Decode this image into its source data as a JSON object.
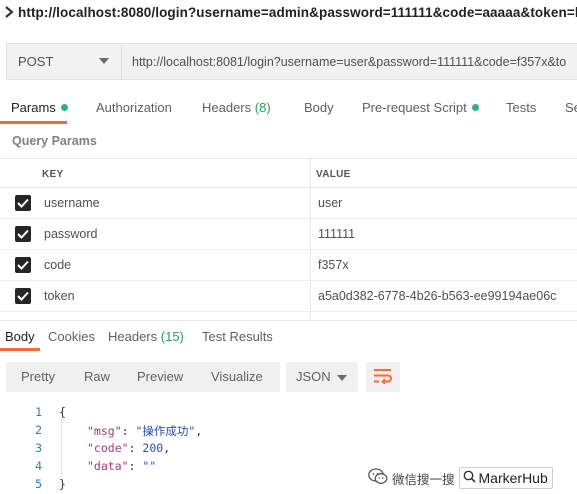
{
  "request_tab": {
    "title": "http://localhost:8080/login?username=admin&password=111111&code=aaaaa&token=b"
  },
  "request": {
    "method": "POST",
    "url": "http://localhost:8081/login?username=user&password=111111&code=f357x&to"
  },
  "request_tabs": [
    {
      "label": "Params",
      "dot": true,
      "active": true
    },
    {
      "label": "Authorization"
    },
    {
      "label": "Headers",
      "count": "(8)"
    },
    {
      "label": "Body"
    },
    {
      "label": "Pre-request Script",
      "dot": true
    },
    {
      "label": "Tests"
    },
    {
      "label": "Se"
    }
  ],
  "query_params": {
    "title": "Query Params",
    "columns": [
      "KEY",
      "VALUE"
    ],
    "rows": [
      {
        "checked": true,
        "key": "username",
        "value": "user"
      },
      {
        "checked": true,
        "key": "password",
        "value": "111111"
      },
      {
        "checked": true,
        "key": "code",
        "value": "f357x"
      },
      {
        "checked": true,
        "key": "token",
        "value": "a5a0d382-6778-4b26-b563-ee99194ae06c"
      }
    ]
  },
  "response_tabs": [
    {
      "label": "Body",
      "active": true
    },
    {
      "label": "Cookies"
    },
    {
      "label": "Headers",
      "count": "(15)"
    },
    {
      "label": "Test Results"
    }
  ],
  "response_toolbar": {
    "formats": [
      "Pretty",
      "Raw",
      "Preview",
      "Visualize"
    ],
    "active_format": "Pretty",
    "language": "JSON",
    "wrap_icon": "wrap-lines-icon"
  },
  "response_body": {
    "line_numbers": [
      "1",
      "2",
      "3",
      "4",
      "5"
    ],
    "open_brace": "{",
    "close_brace": "}",
    "msg_key": "\"msg\"",
    "msg_value": "\"操作成功\"",
    "code_key": "\"code\"",
    "code_value": "200",
    "data_key": "\"data\"",
    "data_value": "\"\""
  },
  "watermark": {
    "text": "微信搜一搜",
    "brand": "MarkerHub",
    "icon": "wechat-icon"
  },
  "colors": {
    "accent": "#f26b3a",
    "dot_green": "#26b47f",
    "count_green": "#2e9d5a",
    "line_number_blue": "#2b78c2",
    "json_key": "#a23a7a",
    "json_value": "#2a4fb2"
  }
}
